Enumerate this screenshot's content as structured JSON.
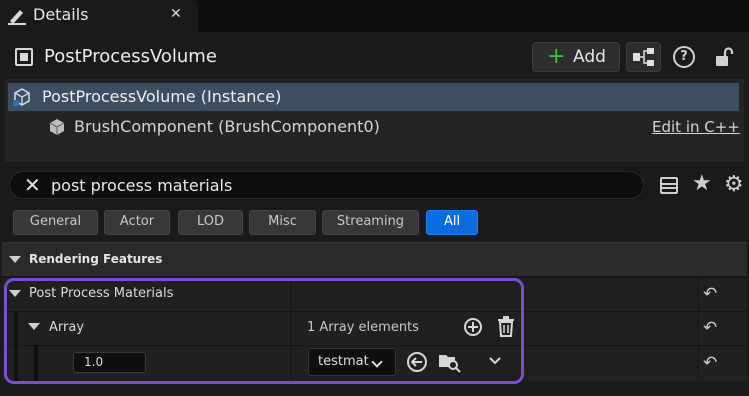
{
  "tab": {
    "title": "Details",
    "close": "✕",
    "icon": "pencil-icon"
  },
  "header": {
    "actor_name": "PostProcessVolume",
    "add_label": "Add",
    "add_plus": "+"
  },
  "components": [
    {
      "label": "PostProcessVolume (Instance)",
      "selected": true
    },
    {
      "label": "BrushComponent (BrushComponent0)",
      "selected": false
    }
  ],
  "edit_link": "Edit in C++",
  "search": {
    "value": "post process materials",
    "clear": "✕"
  },
  "toolbar": {
    "star": "★",
    "gear": "⚙"
  },
  "filters": [
    {
      "label": "General",
      "active": false
    },
    {
      "label": "Actor",
      "active": false
    },
    {
      "label": "LOD",
      "active": false
    },
    {
      "label": "Misc",
      "active": false
    },
    {
      "label": "Streaming",
      "active": false
    },
    {
      "label": "All",
      "active": true
    }
  ],
  "category": {
    "label": "Rendering Features"
  },
  "properties": {
    "ppm": {
      "label": "Post Process Materials"
    },
    "array": {
      "label": "Array",
      "count": "1 Array elements"
    },
    "element": {
      "weight": "1.0",
      "asset": "testmat"
    }
  },
  "reset_glyph": "↶",
  "colors": {
    "accent_blue": "#0a6cde",
    "highlight": "#7c4ed6",
    "add_green": "#3fbf3f",
    "selected_row": "#3d4d62"
  }
}
